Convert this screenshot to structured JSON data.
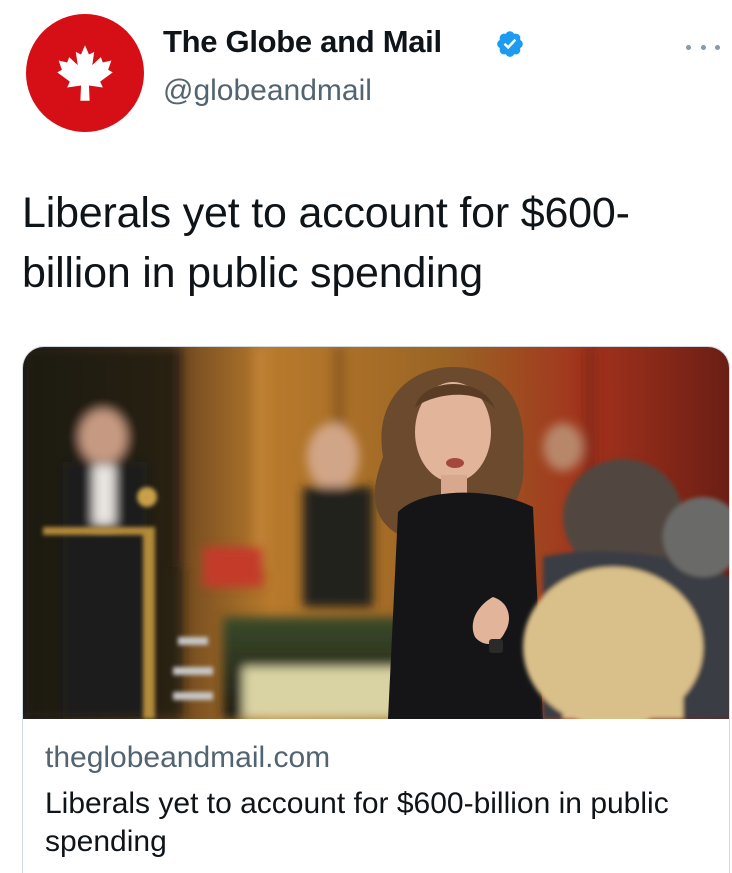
{
  "author": {
    "display_name": "The Globe and Mail",
    "handle": "@globeandmail",
    "verified": true,
    "avatar_icon": "maple-leaf-icon",
    "avatar_color": "#d50f15"
  },
  "more_icon": "more-options-icon",
  "tweet": {
    "text": "Liberals yet to account for $600-billion in public spending"
  },
  "link_card": {
    "image_icon": "parliament-photo",
    "domain": "theglobeandmail.com",
    "title": "Liberals yet to account for $600-billion in public spending"
  },
  "colors": {
    "text_primary": "#0f1419",
    "text_secondary": "#536471",
    "verified_blue": "#1d9bf0",
    "border": "#cfd9de"
  }
}
